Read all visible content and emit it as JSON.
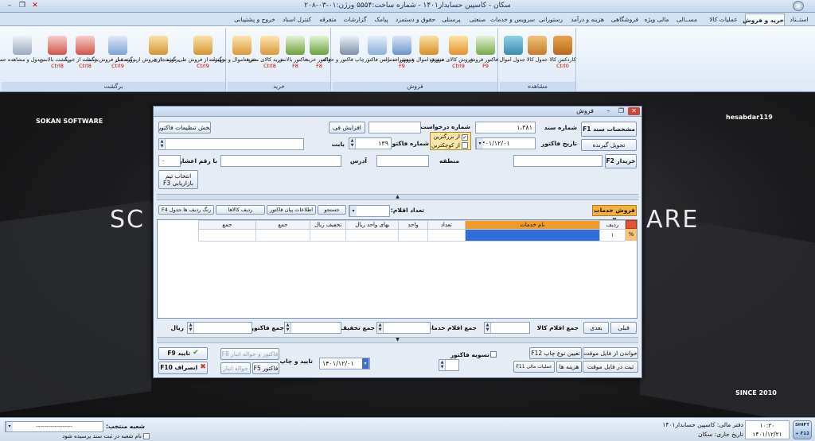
{
  "window": {
    "title": "سکان - کاسپین حسابدار۱۴۰۱ - شماره ساخت:۵۵۵۴ ورژن:۰۱-۰۳-۲۰۸",
    "minimize": "–",
    "restore": "❐",
    "close": "✕"
  },
  "ribbon": {
    "tabs": [
      "استــناد",
      "خرید و فروش",
      "عملیات کالا",
      "مســالی",
      "مالی ویژه",
      "فروشگاهی",
      "هزینه و درآمد",
      "رستورانی",
      "سرویس و خدمات",
      "صنعتی",
      "پرسنلی",
      "حقوق و دستمزد",
      "پیامک",
      "گزارشات",
      "متفرقه",
      "کنترل اسناد",
      "خروج و پشتیبانی"
    ],
    "active_tab": 1,
    "groups": [
      {
        "label": "مشاهده",
        "buttons": [
          {
            "label": "کاردکس کالا",
            "hotkey": "Ctrl0"
          },
          {
            "label": "جدول کالا",
            "hotkey": ""
          },
          {
            "label": "جدول اموال",
            "hotkey": ""
          }
        ]
      },
      {
        "label": "فروش",
        "buttons": [
          {
            "label": "فاکتور فروش",
            "hotkey": "F9"
          },
          {
            "label": "فروش کالای متفرقه",
            "hotkey": "Ctrl9"
          },
          {
            "label": "فروش اموال و تجهیزات",
            "hotkey": ""
          },
          {
            "label": "فروش خدمات",
            "hotkey": "F9"
          },
          {
            "label": "راس فاکتور",
            "hotkey": ""
          },
          {
            "label": "چاپ فاکتور و حواله",
            "hotkey": ""
          }
        ]
      },
      {
        "label": "خرید",
        "buttons": [
          {
            "label": "فاکتور خرید",
            "hotkey": "F8"
          },
          {
            "label": "فاکتور بالانس",
            "hotkey": "F8"
          },
          {
            "label": "خرید کالای متفرقه",
            "hotkey": "Ctrl8"
          },
          {
            "label": "خرید اموال و تجهیزات",
            "hotkey": ""
          }
        ]
      },
      {
        "label": "برگشت",
        "buttons": [
          {
            "label": "برگشت از فروش طی دوره جاری",
            "hotkey": "Ctrl9"
          },
          {
            "label": "برگشت از فروش از دوره قبل",
            "hotkey": ""
          },
          {
            "label": "برگشت از فروش خدمات",
            "hotkey": "Ctrl9"
          },
          {
            "label": "برگشت از خرید",
            "hotkey": "Ctrl8"
          },
          {
            "label": "برگشت بالانس",
            "hotkey": "Ctrl8"
          },
          {
            "label": "جدول و مشاهده حسابها",
            "hotkey": ""
          }
        ]
      }
    ]
  },
  "background": {
    "brand_left": "SOKAN SOFTWARE",
    "brand_right": "hesabdar119",
    "big_left": "SC",
    "big_right": "ARE",
    "since": "SINCE 2010"
  },
  "dialog": {
    "title": "فروش",
    "header": {
      "btn_sanad": "مشخصات سند F1",
      "btn_tahvil": "تحویل گیرنده",
      "lbl_sanad": "شماره سند",
      "sanad_value": "۱،۳۸۱",
      "lbl_tarikh": "تاریخ فاکتور",
      "tarikh_value": "۱۴۰۱/۱۲/۰۱",
      "opt_big": "از بزرگترین",
      "opt_small": "از کوچکترین",
      "lbl_darkhast": "شماره درخواست",
      "lbl_factor_no": "شماره فاکتور",
      "factor_no_value": "۱۳۹",
      "lbl_babat": "بابت",
      "btn_settings": "بخش تنظیمات فاکتور",
      "btn_afzayesh": "افزایش فی",
      "btn_kharidar": "خریدار F2",
      "lbl_mantaghe": "منطقه",
      "lbl_address": "آدرس",
      "lbl_ashar": "با رقم اعشار",
      "ashar_value": "۰",
      "btn_team": "انتخاب تیم بازاریابی F3"
    },
    "tab_label": "فروش خدمات ۲",
    "items_count_label": "تعداد اقلام:",
    "toolbar": {
      "search": "جستجو",
      "payan": "اطلاعات پیان فاکتور",
      "radif": "ردیف کالاها",
      "rang": "رنگ ردیف ها جدول F4"
    },
    "grid": {
      "columns": [
        "ردیف",
        "نام خدمات",
        "تعداد",
        "واحد",
        "بهای واحد ریال",
        "تخفیف ریال",
        "جمع",
        "جمع"
      ],
      "rows": [
        {
          "radif": "۱",
          "name": "",
          "tedad": "",
          "vahed": "",
          "baha": "",
          "takhfif": "",
          "jam1": "",
          "jam2": ""
        }
      ],
      "marker": "%"
    },
    "totals": {
      "btn_prev": "قبلی",
      "btn_next": "بعدی",
      "lbl_kala": "جمع اقلام کالا",
      "lbl_khadamat": "جمع اقلام خدماتی",
      "lbl_takhfif": "جمع تخفیف",
      "lbl_factor": "جمع فاکتور",
      "lbl_rial": "ریال"
    },
    "footer": {
      "btn_read_temp": "خواندن از فایل موقت",
      "btn_save_temp": "ثبت در فایل موقت",
      "btn_print_type": "تعیین نوع چاپ F12",
      "btn_hazine": "هزینه ها",
      "btn_bank": "عملیات مالی F11",
      "lbl_tasvie": "تسویه فاکتور",
      "tasvie_value": "۰",
      "lbl_print": "تایید و چاپ",
      "print_date": "۱۴۰۱/۱۲/۰۱",
      "btn_factor_f5": "فاکتور F5",
      "btn_factor_havale": "فاکتور و حواله انبار F8",
      "btn_havale": "حواله انبار",
      "btn_confirm": "تایید F9",
      "btn_cancel": "انصراف F10"
    }
  },
  "status": {
    "shobe_label": "شعبه منتخب:",
    "shobe_value": "------------------",
    "chk_label": "نام شعبه در ثبت سند پرسیده شود",
    "daftar": "دفتر مالی: کاسپین حسابدار۱۴۰۱",
    "tarikh_jari": "تاریخ جاری: سکان",
    "time": "۱۰:۲۰",
    "date": "۱۴۰۱/۱۲/۲۱",
    "shift": "SHIFT + F12"
  }
}
